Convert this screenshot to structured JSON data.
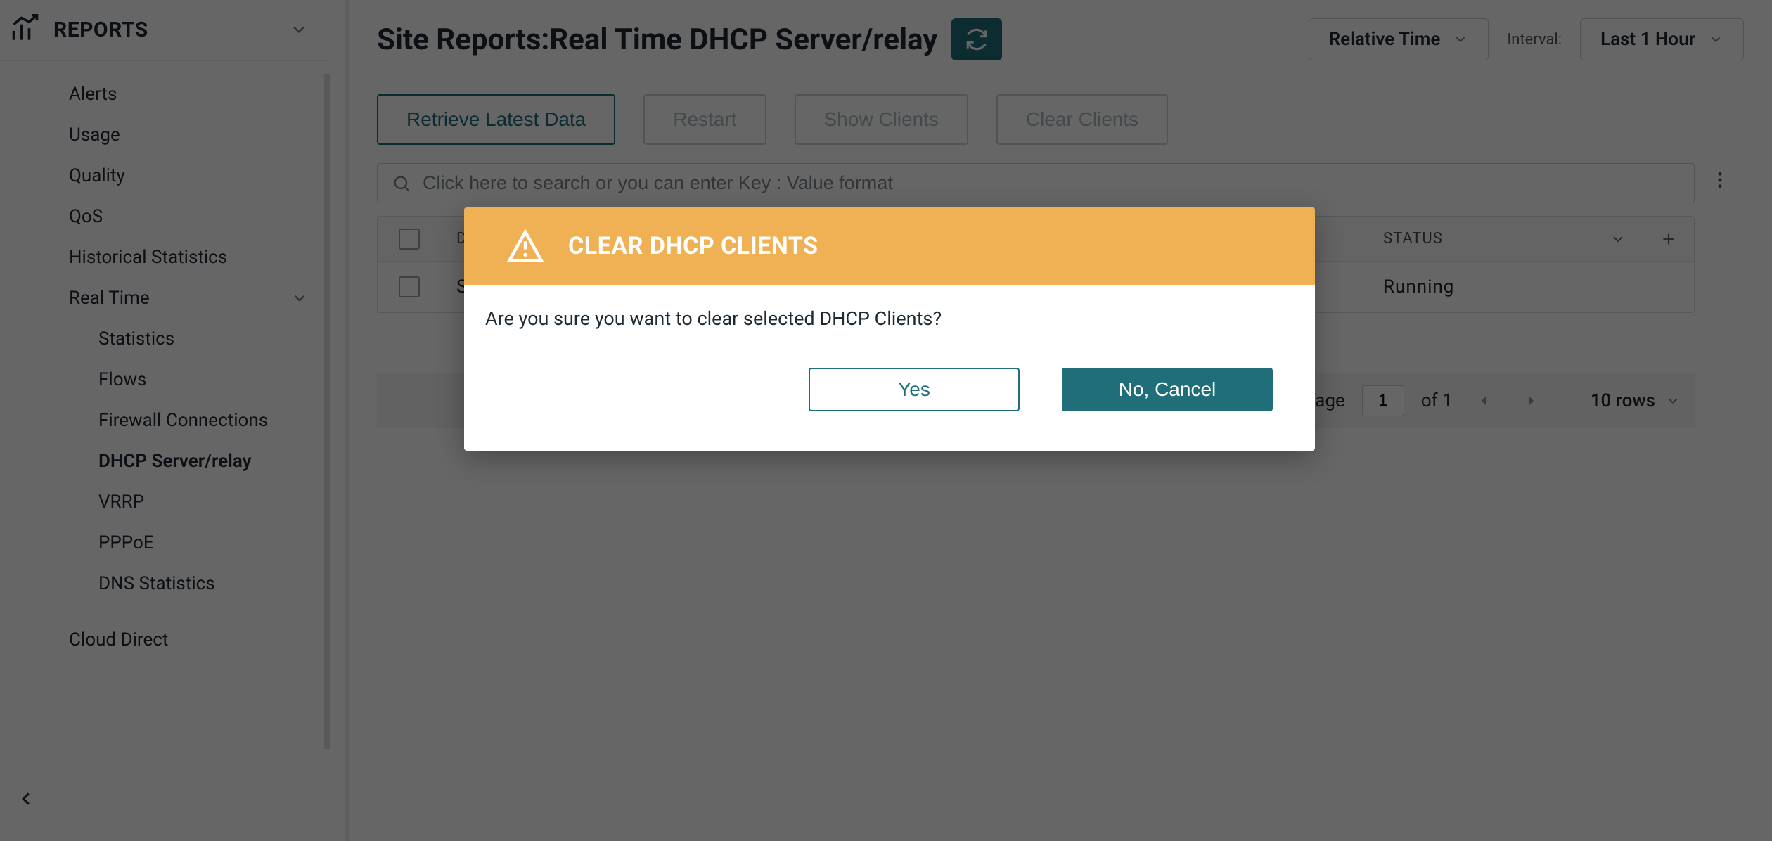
{
  "sidebar": {
    "header": "REPORTS",
    "items": [
      {
        "label": "Alerts"
      },
      {
        "label": "Usage"
      },
      {
        "label": "Quality"
      },
      {
        "label": "QoS"
      },
      {
        "label": "Historical Statistics"
      },
      {
        "label": "Real Time",
        "expandable": true
      }
    ],
    "realtime_children": [
      {
        "label": "Statistics"
      },
      {
        "label": "Flows"
      },
      {
        "label": "Firewall Connections"
      },
      {
        "label": "DHCP Server/relay",
        "active": true
      },
      {
        "label": "VRRP"
      },
      {
        "label": "PPPoE"
      },
      {
        "label": "DNS Statistics"
      }
    ],
    "footer_item": {
      "label": "Cloud Direct"
    }
  },
  "header": {
    "title": "Site Reports:Real Time DHCP Server/relay",
    "timeMode": "Relative Time",
    "intervalLabel": "Interval:",
    "intervalValue": "Last 1 Hour"
  },
  "toolbar": {
    "retrieve": "Retrieve Latest Data",
    "restart": "Restart",
    "show": "Show Clients",
    "clear": "Clear Clients"
  },
  "search": {
    "placeholder": "Click here to search or you can enter Key : Value format"
  },
  "table": {
    "columns": {
      "c1": "DHCP",
      "c2": "STATUS"
    },
    "rows": [
      {
        "c1": "Server",
        "c2": "Running"
      }
    ]
  },
  "pager": {
    "pageLabel": "Page",
    "pageValue": "1",
    "ofLabel": "of 1",
    "rows": "10 rows"
  },
  "modal": {
    "title": "CLEAR DHCP CLIENTS",
    "body": "Are you sure you want to clear selected DHCP Clients?",
    "yes": "Yes",
    "no": "No, Cancel"
  }
}
